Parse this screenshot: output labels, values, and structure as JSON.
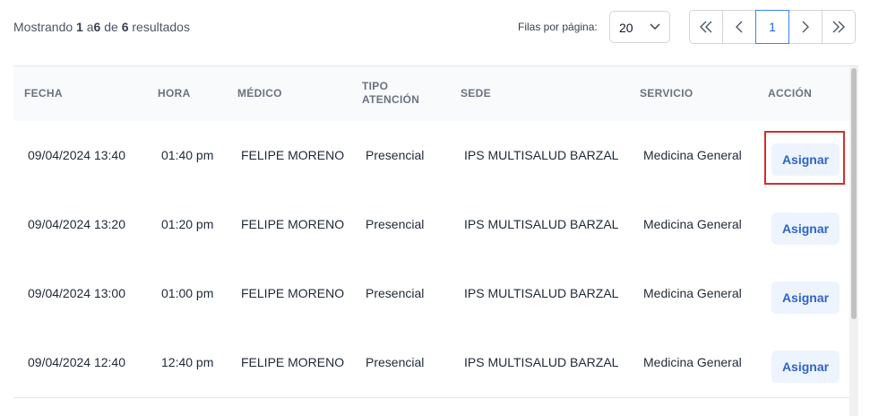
{
  "summary": {
    "prefix": "Mostrando",
    "from": "1",
    "a": "a",
    "to": "6",
    "de": "de",
    "total": "6",
    "suffix": "resultados"
  },
  "rows_per_page": {
    "label": "Filas por página:",
    "value": "20"
  },
  "pager": {
    "current": "1"
  },
  "table": {
    "headers": [
      "FECHA",
      "HORA",
      "MÉDICO",
      "TIPO ATENCIÓN",
      "SEDE",
      "SERVICIO",
      "ACCIÓN"
    ],
    "action_label": "Asignar",
    "rows": [
      {
        "fecha": "09/04/2024 13:40",
        "hora": "01:40 pm",
        "medico": "FELIPE MORENO",
        "tipo": "Presencial",
        "sede": "IPS MULTISALUD BARZAL",
        "servicio": "Medicina General"
      },
      {
        "fecha": "09/04/2024 13:20",
        "hora": "01:20 pm",
        "medico": "FELIPE MORENO",
        "tipo": "Presencial",
        "sede": "IPS MULTISALUD BARZAL",
        "servicio": "Medicina General"
      },
      {
        "fecha": "09/04/2024 13:00",
        "hora": "01:00 pm",
        "medico": "FELIPE MORENO",
        "tipo": "Presencial",
        "sede": "IPS MULTISALUD BARZAL",
        "servicio": "Medicina General"
      },
      {
        "fecha": "09/04/2024 12:40",
        "hora": "12:40 pm",
        "medico": "FELIPE MORENO",
        "tipo": "Presencial",
        "sede": "IPS MULTISALUD BARZAL",
        "servicio": "Medicina General"
      }
    ]
  },
  "colors": {
    "accent": "#2563eb",
    "highlight": "#d32f2f",
    "button_bg": "#eef4fd"
  },
  "icons": [
    "first-page-icon",
    "prev-page-icon",
    "next-page-icon",
    "last-page-icon",
    "chevron-down-icon"
  ]
}
